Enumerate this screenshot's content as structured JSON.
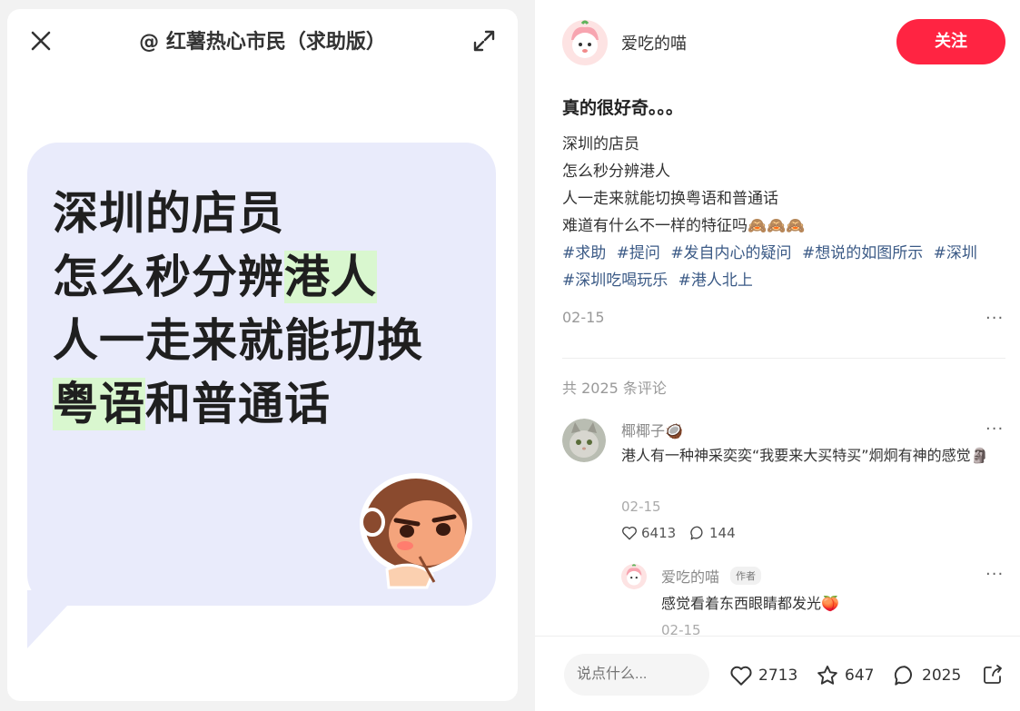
{
  "left": {
    "title": "@ 红薯热心市民（求助版）",
    "lines": [
      [
        "深圳的店员"
      ],
      [
        "怎么秒分辨",
        "港人"
      ],
      [
        "人一走来就能切换"
      ],
      [
        "粤语",
        "和普通话"
      ]
    ]
  },
  "post": {
    "author": "爱吃的喵",
    "follow_label": "关注",
    "title": "真的很好奇。。。",
    "body": [
      "深圳的店员",
      "怎么秒分辨港人",
      "人一走来就能切换粤语和普通话",
      "难道有什么不一样的特征吗🙈🙈🙈"
    ],
    "tags": [
      "#求助",
      "#提问",
      "#发自内心的疑问",
      "#想说的如图所示",
      "#深圳",
      "#深圳吃喝玩乐",
      "#港人北上"
    ],
    "date": "02-15",
    "comment_count": "共 2025 条评论"
  },
  "comment": {
    "name": "椰椰子🥥",
    "text": "港人有一种神采奕奕“我要来大买特买”炯炯有神的感觉🗿",
    "date": "02-15",
    "likes": "6413",
    "replies": "144"
  },
  "reply": {
    "name": "爱吃的喵",
    "badge": "作者",
    "text": "感觉看着东西眼睛都发光🍑",
    "date": "02-15"
  },
  "bottom": {
    "placeholder": "说点什么...",
    "likes": "2713",
    "stars": "647",
    "comments": "2025"
  },
  "colors": {
    "accent": "#ff2442",
    "tag": "#3b5a86",
    "bubble": "#e9ebfb",
    "highlight": "#d9f7cf"
  }
}
